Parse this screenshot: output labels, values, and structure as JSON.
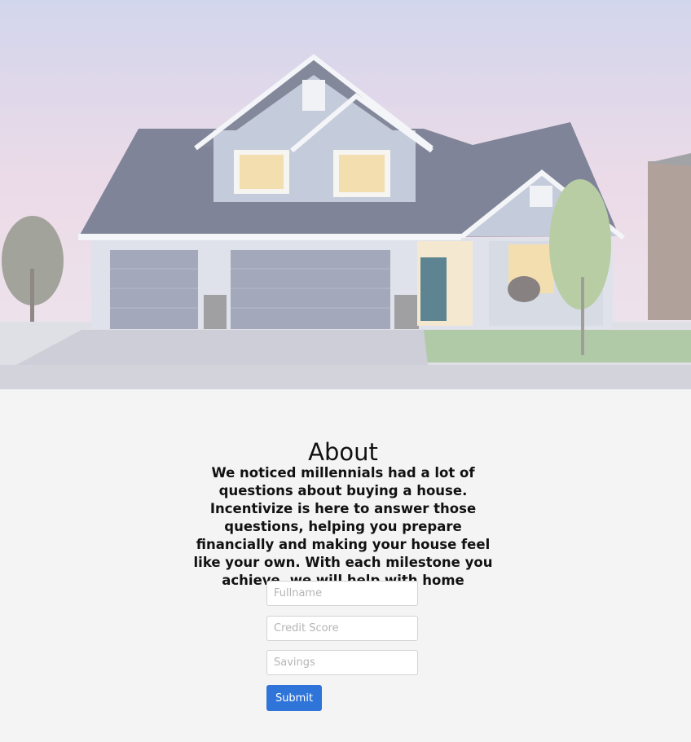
{
  "hero": {
    "image": "house-photo",
    "overlay_color": "#ffffff"
  },
  "about": {
    "title": "About",
    "body": "We noticed millennials had a lot of questions about buying a house. Incentivize is here to answer those questions, helping you prepare financially and making your house feel like your own. With each milestone you achieve, we will help with home improvement. ."
  },
  "form": {
    "fullname_placeholder": "Fullname",
    "credit_score_placeholder": "Credit Score",
    "savings_placeholder": "Savings",
    "submit_label": "Submit"
  },
  "colors": {
    "accent": "#2f74d8",
    "background": "#f4f4f4"
  }
}
